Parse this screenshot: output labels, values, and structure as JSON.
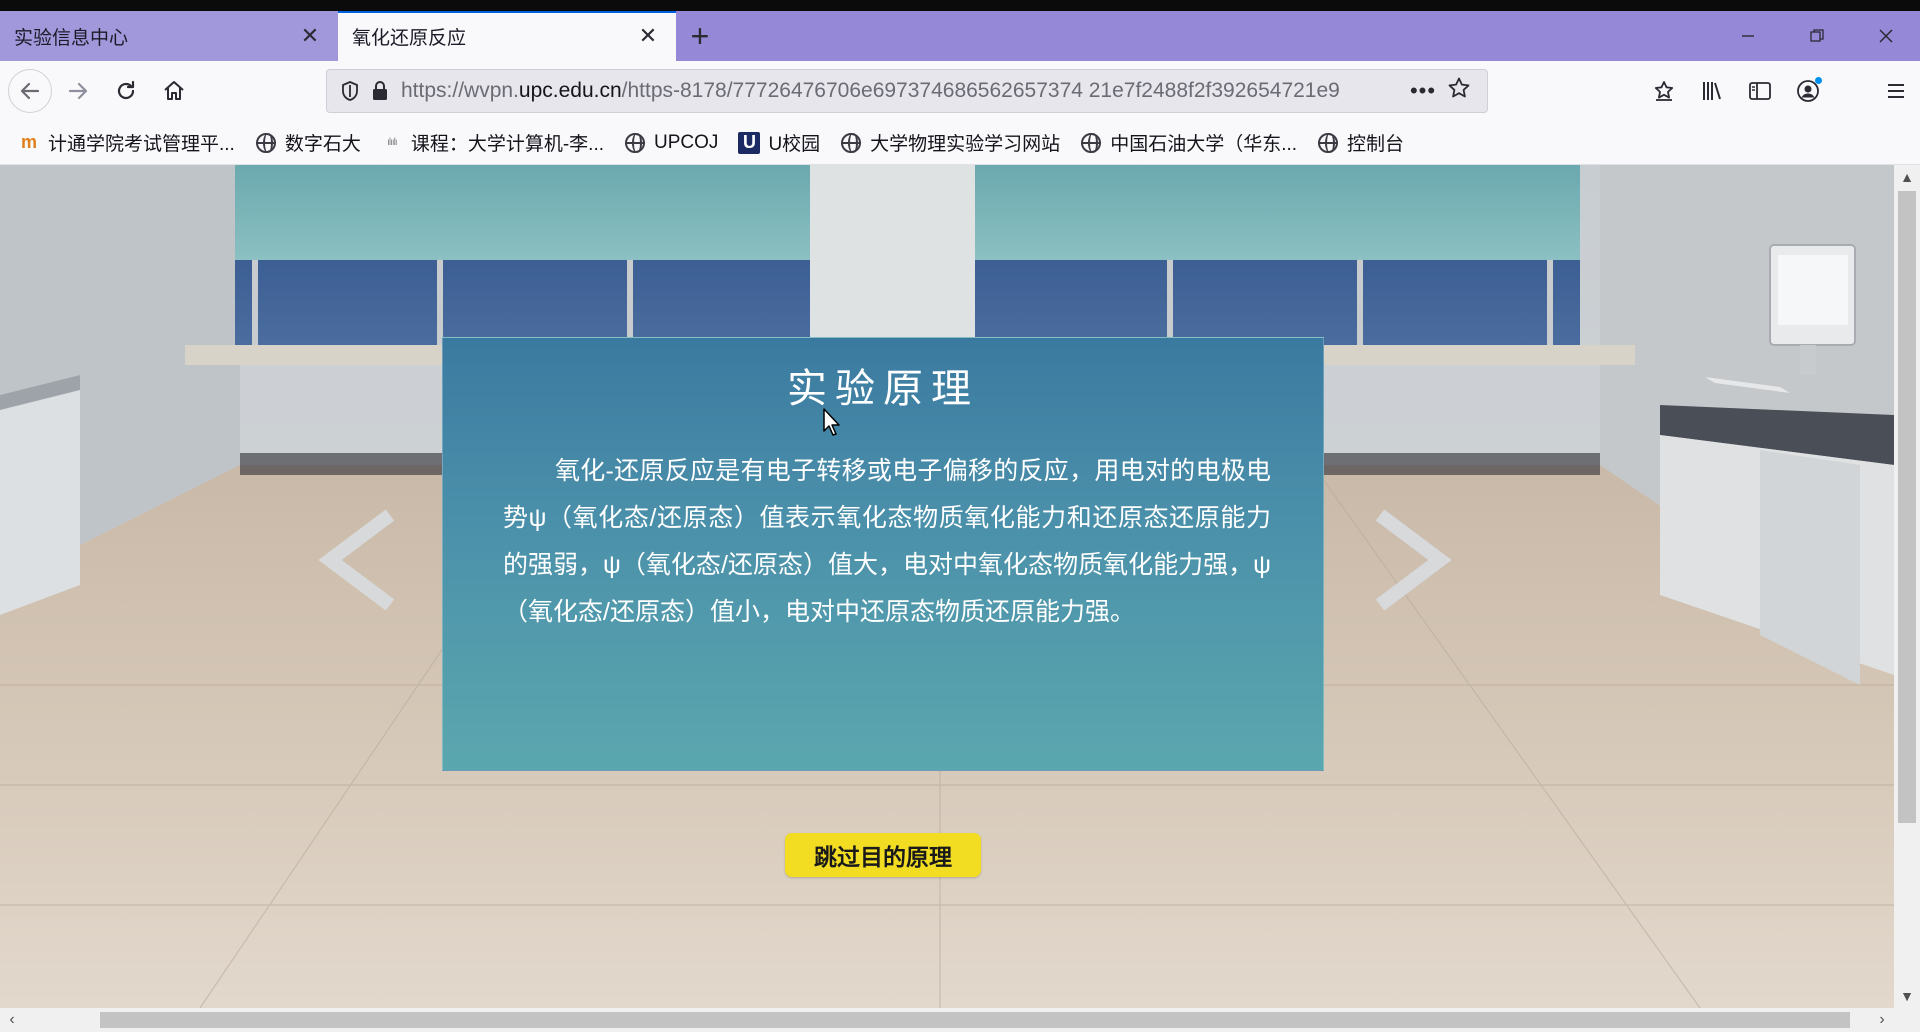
{
  "browser": {
    "tabs": [
      {
        "label": "实验信息中心",
        "active": false
      },
      {
        "label": "氧化还原反应",
        "active": true
      }
    ],
    "close_glyph": "✕",
    "new_tab_glyph": "+",
    "window_controls": {
      "minimize": "—",
      "restore": "❐",
      "close": "✕"
    },
    "url": {
      "prefix": "https://wvpn.",
      "host": "upc.edu.cn",
      "path": "/https-8178/77726476706e697374686562657374 21e7f2488f2f392654721e9"
    },
    "page_actions_glyph": "•••",
    "bookmarks": [
      {
        "label": "计通学院考试管理平...",
        "icon": "school-logo"
      },
      {
        "label": "数字石大",
        "icon": "globe-icon"
      },
      {
        "label": "课程：大学计算机-李...",
        "icon": "cisco-logo"
      },
      {
        "label": "UPCOJ",
        "icon": "globe-icon"
      },
      {
        "label": "U校园",
        "icon": "u-logo"
      },
      {
        "label": "大学物理实验学习网站",
        "icon": "globe-icon"
      },
      {
        "label": "中国石油大学（华东...",
        "icon": "globe-icon"
      },
      {
        "label": "控制台",
        "icon": "globe-icon"
      }
    ]
  },
  "page": {
    "dialog_title": "实验原理",
    "dialog_body": "氧化-还原反应是有电子转移或电子偏移的反应，用电对的电极电势ψ（氧化态/还原态）值表示氧化态物质氧化能力和还原态还原能力的强弱，ψ（氧化态/还原态）值大，电对中氧化态物质氧化能力强，ψ（氧化态/还原态）值小，电对中还原态物质还原能力强。",
    "skip_button": "跳过目的原理"
  },
  "colors": {
    "tab_strip": "#9588d6",
    "toolbar": "#f9f9fb",
    "dialog": "#4a8faa",
    "skip_button": "#f2dd22"
  }
}
